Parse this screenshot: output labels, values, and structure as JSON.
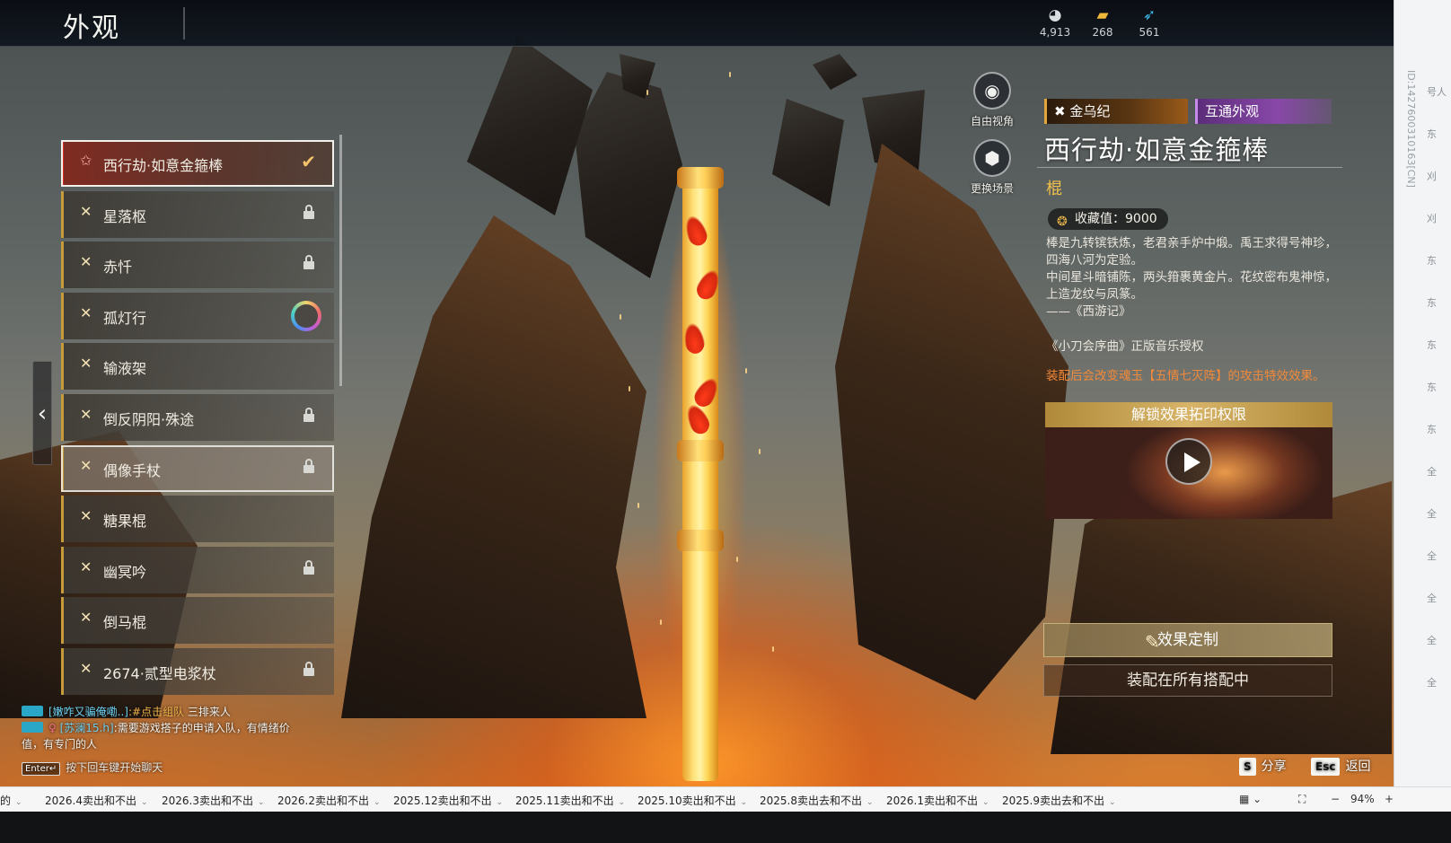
{
  "screen": {
    "title": "外观",
    "currencies": [
      {
        "icon": "ghost-coin-icon",
        "value": "4,913"
      },
      {
        "icon": "gold-ticket-icon",
        "value": "268"
      },
      {
        "icon": "feather-icon",
        "value": "561"
      }
    ]
  },
  "side_id": "ID:1427600310163[CN]",
  "skins": [
    {
      "label": "西行劫·如意金箍棒",
      "state": "selected"
    },
    {
      "label": "星落枢",
      "state": "locked"
    },
    {
      "label": "赤忏",
      "state": "locked"
    },
    {
      "label": "孤灯行",
      "state": "color"
    },
    {
      "label": "输液架",
      "state": "owned"
    },
    {
      "label": "倒反阴阳·殊途",
      "state": "locked"
    },
    {
      "label": "偶像手杖",
      "state": "hovered-locked"
    },
    {
      "label": "糖果棍",
      "state": "owned"
    },
    {
      "label": "幽冥吟",
      "state": "locked"
    },
    {
      "label": "倒马棍",
      "state": "owned"
    },
    {
      "label": "2674·贰型电浆杖",
      "state": "locked"
    }
  ],
  "camera": {
    "free_view": "自由视角",
    "change_scene": "更换场景"
  },
  "detail": {
    "series_tag": "金乌纪",
    "shared_tag": "互通外观",
    "name": "西行劫·如意金箍棒",
    "type": "棍",
    "collect_label": "收藏值：9000",
    "desc_lines": [
      "棒是九转镔铁炼，老君亲手炉中煅。禹王求得号神珍，四海八河为定验。",
      "中间星斗暗铺陈，两头箝裹黄金片。花纹密布鬼神惊，上造龙纹与凤篆。",
      "——《西游记》"
    ],
    "music": "《小刀会序曲》正版音乐授权",
    "effect": "装配后会改变魂玉【五情七灭阵】的攻击特效效果。",
    "unlock_title": "解锁效果拓印权限",
    "btn_custom": "效果定制",
    "btn_equip": "装配在所有搭配中"
  },
  "chat": {
    "line1_name": "[嫩咋又骗俺嘞..]",
    "line1_link": ":#点击组队",
    "line1_rest": " 三排来人",
    "line2_name": "[苏澜15.h]",
    "line2_rest": ":需要游戏搭子的申请入队，有情绪价值，有专门的人",
    "hint_key": "Enter↵",
    "hint": "按下回车键开始聊天"
  },
  "hotkeys": {
    "share_key": "S",
    "share": "分享",
    "back_key": "Esc",
    "back": "返回"
  },
  "browser_tabs": [
    "的",
    "2026.4卖出和不出",
    "2026.3卖出和不出",
    "2026.2卖出和不出",
    "2025.12卖出和不出",
    "2025.11卖出和不出",
    "2025.10卖出和不出",
    "2025.8卖出去和不出",
    "2026.1卖出和不出",
    "2025.9卖出去和不出"
  ],
  "browser_controls": {
    "zoom": "94%",
    "minus": "−",
    "plus": "+"
  },
  "edge_chars": [
    "号人",
    "东",
    "刈",
    "刈",
    "东",
    "东",
    "东",
    "东",
    "东",
    "全",
    "全",
    "全",
    "全",
    "全",
    "全"
  ]
}
